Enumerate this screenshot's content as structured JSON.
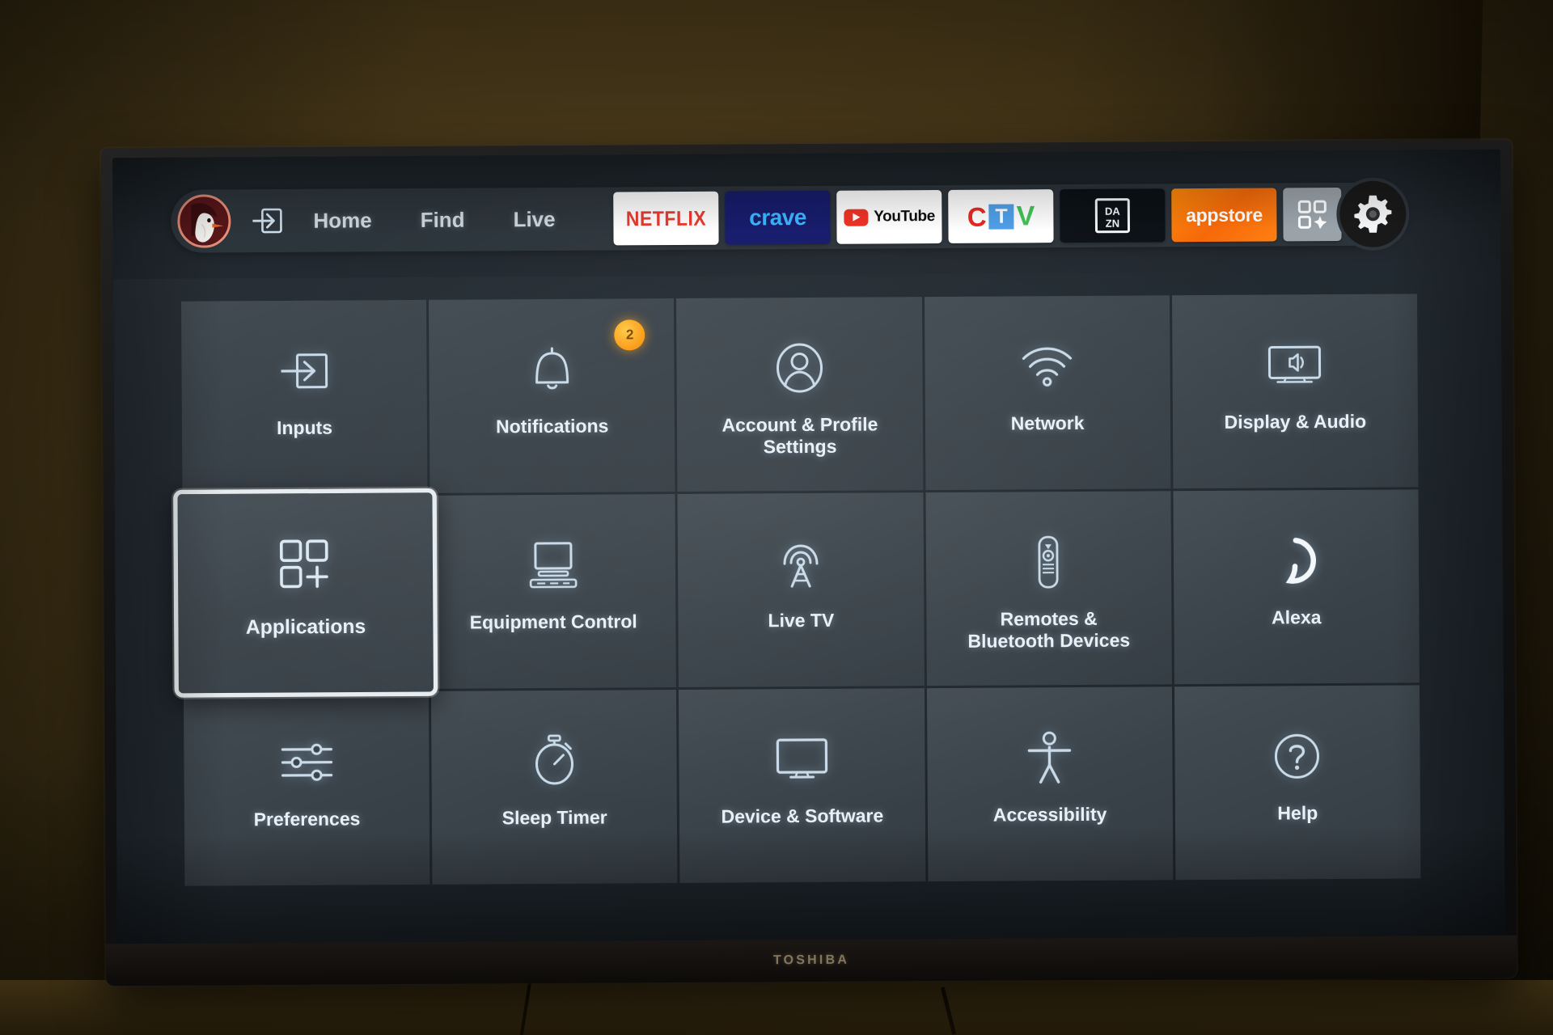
{
  "device": {
    "brand": "TOSHIBA"
  },
  "topbar": {
    "avatar_label": "profile-avatar",
    "input_icon_label": "inputs",
    "nav": [
      {
        "label": "Home"
      },
      {
        "label": "Find"
      },
      {
        "label": "Live"
      }
    ],
    "apps": [
      {
        "name": "netflix",
        "label": "NETFLIX",
        "bg": "#ffffff",
        "fg": "#e8392f"
      },
      {
        "name": "crave",
        "label": "crave",
        "bg": "#151a6b",
        "fg": "#38b6ff"
      },
      {
        "name": "youtube",
        "label": "YouTube",
        "bg": "#ffffff",
        "fg": "#0d0d0d"
      },
      {
        "name": "ctv",
        "label": "CTV",
        "bg": "#ffffff",
        "fg": "#e8251f"
      },
      {
        "name": "dazn",
        "label": "DAZN",
        "bg": "#0c1116",
        "fg": "#ffffff"
      },
      {
        "name": "appstore",
        "label": "appstore",
        "bg": "#f5690a",
        "fg": "#ffffff"
      }
    ],
    "apps_grid_button": "all-apps",
    "settings_button": "settings"
  },
  "grid": {
    "tiles": [
      {
        "label": "Inputs",
        "icon": "input-arrow-icon",
        "selected": false,
        "badge": null
      },
      {
        "label": "Notifications",
        "icon": "bell-icon",
        "selected": false,
        "badge": "2"
      },
      {
        "label": "Account & Profile Settings",
        "icon": "person-circle-icon",
        "selected": false,
        "badge": null
      },
      {
        "label": "Network",
        "icon": "wifi-icon",
        "selected": false,
        "badge": null
      },
      {
        "label": "Display & Audio",
        "icon": "tv-speaker-icon",
        "selected": false,
        "badge": null
      },
      {
        "label": "Applications",
        "icon": "apps-grid-plus-icon",
        "selected": true,
        "badge": null
      },
      {
        "label": "Equipment Control",
        "icon": "monitor-keyboard-icon",
        "selected": false,
        "badge": null
      },
      {
        "label": "Live TV",
        "icon": "broadcast-tower-icon",
        "selected": false,
        "badge": null
      },
      {
        "label": "Remotes & Bluetooth Devices",
        "icon": "remote-control-icon",
        "selected": false,
        "badge": null
      },
      {
        "label": "Alexa",
        "icon": "alexa-ring-icon",
        "selected": false,
        "badge": null
      },
      {
        "label": "Preferences",
        "icon": "sliders-icon",
        "selected": false,
        "badge": null
      },
      {
        "label": "Sleep Timer",
        "icon": "stopwatch-icon",
        "selected": false,
        "badge": null
      },
      {
        "label": "Device & Software",
        "icon": "tv-icon",
        "selected": false,
        "badge": null
      },
      {
        "label": "Accessibility",
        "icon": "accessibility-person-icon",
        "selected": false,
        "badge": null
      },
      {
        "label": "Help",
        "icon": "question-circle-icon",
        "selected": false,
        "badge": null
      }
    ]
  },
  "colors": {
    "screen_bg": "#222a31",
    "tile_bg": "#3b444b",
    "icon_stroke": "#c9dae8",
    "accent_badge": "#fba01a",
    "selection_border": "#e6ecef",
    "wall": "#463718"
  }
}
